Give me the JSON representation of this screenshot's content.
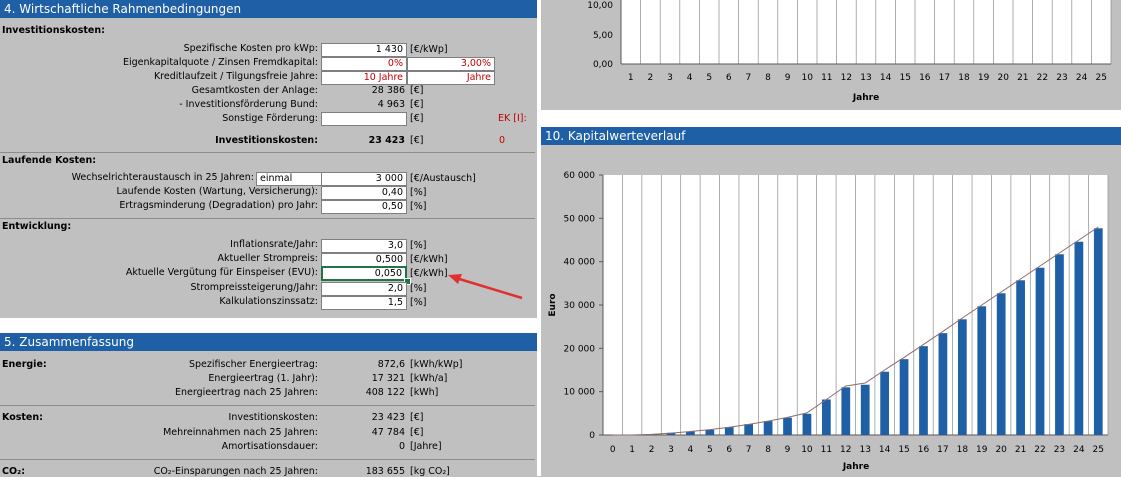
{
  "section4": {
    "title": "4. Wirtschaftliche Rahmenbedingungen",
    "invest": {
      "heading": "Investitionskosten:",
      "rows": [
        {
          "label": "Spezifische Kosten pro kWp:",
          "value": "1 430",
          "unit": "[€/kWp]"
        },
        {
          "label": "Eigenkapitalquote / Zinsen Fremdkapital:",
          "value": "0%",
          "value2": "3,00%"
        },
        {
          "label": "Kreditlaufzeit / Tilgungsfreie Jahre:",
          "value": "10 Jahre",
          "value2": "Jahre"
        },
        {
          "label": "Gesamtkosten der Anlage:",
          "value": "28 386",
          "unit": "[€]"
        },
        {
          "label": "- Investitionsförderung Bund:",
          "value": "4 963",
          "unit": "[€]"
        },
        {
          "label": "Sonstige Förderung:",
          "value": "",
          "unit": "[€]"
        },
        {
          "label": "Investitionskosten:",
          "value": "23 423",
          "unit": "[€]"
        }
      ],
      "ek_label": "EK [I]:",
      "ek_value": "0"
    },
    "running": {
      "heading": "Laufende Kosten:",
      "rows": [
        {
          "label": "Wechselrichteraustausch in 25 Jahren:",
          "select": "einmal",
          "value": "3 000",
          "unit": "[€/Austausch]"
        },
        {
          "label": "Laufende Kosten (Wartung, Versicherung):",
          "value": "0,40",
          "unit": "[%]"
        },
        {
          "label": "Ertragsminderung (Degradation) pro Jahr:",
          "value": "0,50",
          "unit": "[%]"
        }
      ]
    },
    "development": {
      "heading": "Entwicklung:",
      "rows": [
        {
          "label": "Inflationsrate/Jahr:",
          "value": "3,0",
          "unit": "[%]"
        },
        {
          "label": "Aktueller Strompreis:",
          "value": "0,500",
          "unit": "[€/kWh]"
        },
        {
          "label": "Aktuelle Vergütung für Einspeiser (EVU):",
          "value": "0,050",
          "unit": "[€/kWh]"
        },
        {
          "label": "Strompreissteigerung/Jahr:",
          "value": "2,0",
          "unit": "[%]"
        },
        {
          "label": "Kalkulationszinssatz:",
          "value": "1,5",
          "unit": "[%]"
        }
      ]
    }
  },
  "section5": {
    "title": "5. Zusammenfassung",
    "energy": {
      "heading": "Energie:",
      "rows": [
        {
          "label": "Spezifischer Energieertrag:",
          "value": "872,6",
          "unit": "[kWh/kWp]"
        },
        {
          "label": "Energieertrag (1. Jahr):",
          "value": "17 321",
          "unit": "[kWh/a]"
        },
        {
          "label": "Energieertrag nach 25 Jahren:",
          "value": "408 122",
          "unit": "[kWh]"
        }
      ]
    },
    "costs": {
      "heading": "Kosten:",
      "rows": [
        {
          "label": "Investitionskosten:",
          "value": "23 423",
          "unit": "[€]"
        },
        {
          "label": "Mehreinnahmen nach 25 Jahren:",
          "value": "47 784",
          "unit": "[€]"
        },
        {
          "label": "Amortisationsdauer:",
          "value": "0",
          "unit": "[Jahre]"
        }
      ]
    },
    "co2": {
      "heading": "CO₂:",
      "rows": [
        {
          "label": "CO₂-Einsparungen nach 25 Jahren:",
          "value": "183 655",
          "unit": "[kg CO₂]"
        }
      ]
    }
  },
  "top_chart": {
    "yticks": [
      "10,00",
      "5,00",
      "0,00"
    ],
    "xticks": [
      "1",
      "2",
      "3",
      "4",
      "5",
      "6",
      "7",
      "8",
      "9",
      "10",
      "11",
      "12",
      "13",
      "14",
      "15",
      "16",
      "17",
      "18",
      "19",
      "20",
      "21",
      "22",
      "23",
      "24",
      "25"
    ],
    "xlabel": "Jahre"
  },
  "section10": {
    "title": "10. Kapitalwerteverlauf"
  },
  "chart_data": {
    "type": "bar",
    "title": "",
    "xlabel": "Jahre",
    "ylabel": "Euro",
    "ylim": [
      0,
      60000
    ],
    "yticks": [
      "0",
      "10 000",
      "20 000",
      "30 000",
      "40 000",
      "50 000",
      "60 000"
    ],
    "categories": [
      "0",
      "1",
      "2",
      "3",
      "4",
      "5",
      "6",
      "7",
      "8",
      "9",
      "10",
      "11",
      "12",
      "13",
      "14",
      "15",
      "16",
      "17",
      "18",
      "19",
      "20",
      "21",
      "22",
      "23",
      "24",
      "25"
    ],
    "values": [
      0,
      0,
      200,
      500,
      800,
      1200,
      1800,
      2500,
      3200,
      4000,
      4900,
      8200,
      11000,
      11600,
      14600,
      17500,
      20500,
      23500,
      26700,
      29700,
      32700,
      35700,
      38600,
      41700,
      44600,
      47700
    ],
    "line_values": [
      0,
      0,
      150,
      450,
      800,
      1250,
      1800,
      2450,
      3200,
      4050,
      5100,
      8200,
      11300,
      12000,
      15000,
      17900,
      20900,
      23900,
      27000,
      30000,
      33000,
      36000,
      39000,
      42000,
      45000,
      48000
    ],
    "grid": "vertical",
    "bar_color": "#1f5fa6"
  }
}
